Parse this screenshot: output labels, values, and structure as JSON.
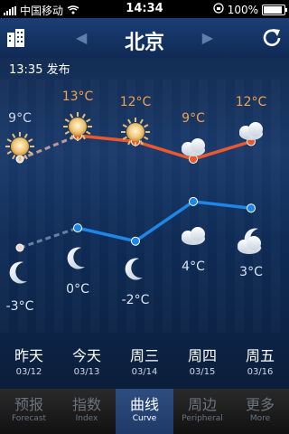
{
  "status": {
    "carrier": "中国移动",
    "time": "14:34",
    "battery": "100%",
    "battery_level": 1.0
  },
  "header": {
    "city": "北京",
    "prev": "◀",
    "next": "▶"
  },
  "publish": "13:35 发布",
  "colors": {
    "high_line": "#e8592e",
    "low_line": "#1e86e6",
    "high_text": "#f0a24e",
    "low_text": "#d9e6f3"
  },
  "chart_data": {
    "type": "line",
    "categories": [
      "昨天",
      "今天",
      "周三",
      "周四",
      "周五"
    ],
    "series": [
      {
        "values": [
          9,
          13,
          12,
          9,
          12
        ]
      },
      {
        "values": [
          -3,
          0,
          -2,
          4,
          3
        ]
      }
    ],
    "high_labels": [
      "9°C",
      "13°C",
      "12°C",
      "9°C",
      "12°C"
    ],
    "low_labels": [
      "-3°C",
      "0°C",
      "-2°C",
      "4°C",
      "3°C"
    ],
    "day_icons": [
      "sun-icon",
      "sun-icon",
      "sun-icon",
      "cloud-icon",
      "cloud-icon"
    ],
    "night_icons": [
      "moon-icon",
      "moon-icon",
      "moon-icon",
      "cloud-icon",
      "cloud-moon-icon"
    ]
  },
  "days": [
    {
      "name": "昨天",
      "date": "03/12"
    },
    {
      "name": "今天",
      "date": "03/13"
    },
    {
      "name": "周三",
      "date": "03/14"
    },
    {
      "name": "周四",
      "date": "03/15"
    },
    {
      "name": "周五",
      "date": "03/16"
    }
  ],
  "tabs": [
    {
      "label": "预报",
      "sub": "Forecast"
    },
    {
      "label": "指数",
      "sub": "Index"
    },
    {
      "label": "曲线",
      "sub": "Curve"
    },
    {
      "label": "周边",
      "sub": "Peripheral"
    },
    {
      "label": "更多",
      "sub": "More"
    }
  ]
}
